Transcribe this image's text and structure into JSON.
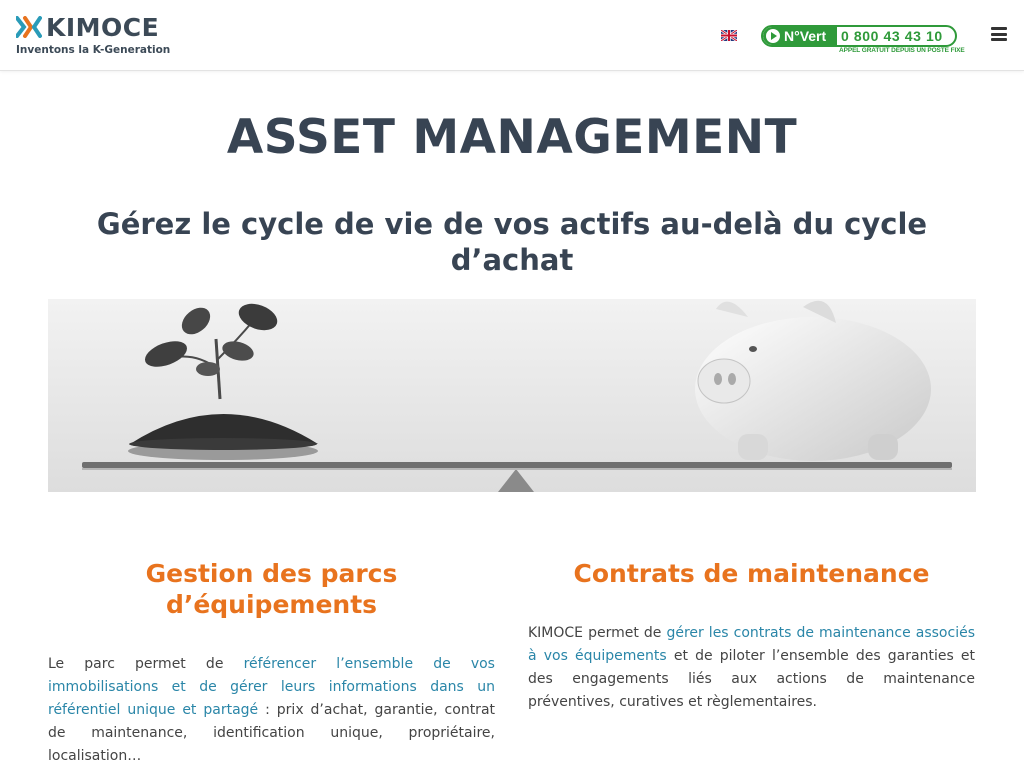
{
  "header": {
    "logo": {
      "name": "KIMOCE",
      "tagline": "Inventons la K-Generation"
    },
    "language_flag": "flag-uk-icon",
    "numero_vert": {
      "label": "N°Vert",
      "number": "0 800 43 43 10",
      "subtitle": "APPEL GRATUIT DEPUIS UN POSTE FIXE"
    },
    "menu_icon": "hamburger-menu-icon"
  },
  "page": {
    "title": "ASSET MANAGEMENT",
    "subtitle": "Gérez le cycle de vie de vos actifs au-delà du cycle d’achat"
  },
  "sections": {
    "left": {
      "title": "Gestion des parcs d’équipements",
      "text_1": "Le parc permet de ",
      "link": "référencer l’ensemble de vos immobilisations et de gérer leurs informations dans un référentiel unique et partagé",
      "text_2": " : prix d’achat, garantie, contrat de maintenance, identification unique, propriétaire, localisation…"
    },
    "right": {
      "title": "Contrats de maintenance",
      "text_1": "KIMOCE permet de ",
      "link": "gérer les contrats de maintenance associés à vos équipements",
      "text_2": " et de piloter l’ensemble des garanties et des engagements liés aux actions de maintenance préventives, curatives et règlementaires."
    }
  },
  "colors": {
    "heading": "#384453",
    "accent": "#e8731e",
    "link": "#2a86a8",
    "numvert_green": "#2f9a3a"
  }
}
